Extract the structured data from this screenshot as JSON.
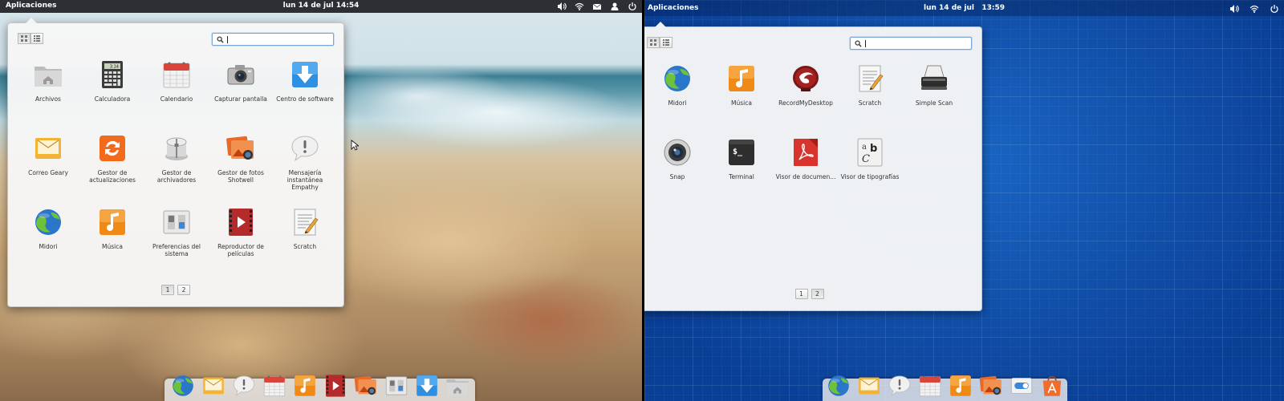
{
  "left": {
    "panel": {
      "apps_label": "Aplicaciones",
      "clock": "lun 14 de jul 14:54"
    },
    "launcher": {
      "search": {
        "value": "",
        "placeholder": ""
      },
      "apps": [
        {
          "label": "Archivos",
          "icon": "folder-home-icon"
        },
        {
          "label": "Calculadora",
          "icon": "calculator-icon"
        },
        {
          "label": "Calendario",
          "icon": "calendar-icon"
        },
        {
          "label": "Capturar pantalla",
          "icon": "camera-icon"
        },
        {
          "label": "Centro de software",
          "icon": "software-center-icon"
        },
        {
          "label": "Correo Geary",
          "icon": "mail-icon"
        },
        {
          "label": "Gestor de actualizaciones",
          "icon": "update-icon"
        },
        {
          "label": "Gestor de archivadores",
          "icon": "archive-icon"
        },
        {
          "label": "Gestor de fotos Shotwell",
          "icon": "photos-icon"
        },
        {
          "label": "Mensajería instantánea Empathy",
          "icon": "chat-icon"
        },
        {
          "label": "Midori",
          "icon": "midori-icon"
        },
        {
          "label": "Música",
          "icon": "music-icon"
        },
        {
          "label": "Preferencias del sistema",
          "icon": "settings-icon"
        },
        {
          "label": "Reproductor de películas",
          "icon": "video-icon"
        },
        {
          "label": "Scratch",
          "icon": "text-editor-icon"
        }
      ],
      "pages": [
        "1",
        "2"
      ],
      "active_page": 0
    },
    "dock": [
      "midori-icon",
      "mail-icon",
      "chat-icon",
      "calendar-icon",
      "music-icon",
      "video-icon",
      "photos-icon",
      "settings-icon",
      "software-center-icon",
      "folder-home-icon"
    ]
  },
  "right": {
    "panel": {
      "apps_label": "Aplicaciones",
      "clock": "lun 14 de jul   13:59"
    },
    "launcher": {
      "search": {
        "value": "",
        "placeholder": ""
      },
      "apps": [
        {
          "label": "Midori",
          "icon": "midori-icon"
        },
        {
          "label": "Música",
          "icon": "music-icon"
        },
        {
          "label": "RecordMyDesktop",
          "icon": "record-icon"
        },
        {
          "label": "Scratch",
          "icon": "text-editor-icon"
        },
        {
          "label": "Simple Scan",
          "icon": "scanner-icon"
        },
        {
          "label": "Snap",
          "icon": "webcam-icon"
        },
        {
          "label": "Terminal",
          "icon": "terminal-icon"
        },
        {
          "label": "Visor de documen...",
          "icon": "pdf-icon"
        },
        {
          "label": "Visor de tipografías",
          "icon": "font-icon"
        }
      ],
      "pages": [
        "1",
        "2"
      ],
      "active_page": 1
    },
    "dock": [
      "midori-icon",
      "mail-icon",
      "chat-icon",
      "calendar-icon",
      "music-icon",
      "photos-icon",
      "switch-icon",
      "store-icon"
    ]
  },
  "colors": {
    "panel_dark": "#141619",
    "launcher_bg": "#f6f6f6",
    "blueprint": "#0b4aa8",
    "search_focus": "#7aa7d8"
  }
}
